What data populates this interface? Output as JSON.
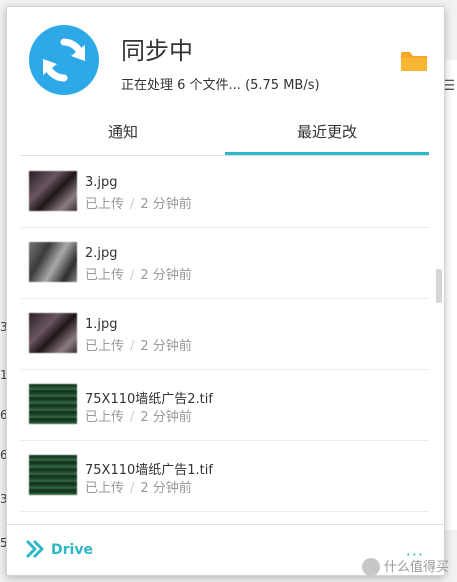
{
  "header": {
    "title": "同步中",
    "subtitle": "正在处理 6 个文件... (5.75 MB/s)"
  },
  "tabs": [
    {
      "label": "通知"
    },
    {
      "label": "最近更改"
    }
  ],
  "files": [
    {
      "name": "3.jpg",
      "status": "已上传",
      "time": "2 分钟前"
    },
    {
      "name": "2.jpg",
      "status": "已上传",
      "time": "2 分钟前"
    },
    {
      "name": "1.jpg",
      "status": "已上传",
      "time": "2 分钟前"
    },
    {
      "name": "75X110墙纸广告2.tif",
      "status": "已上传",
      "time": "2 分钟前"
    },
    {
      "name": "75X110墙纸广告1.tif",
      "status": "已上传",
      "time": "2 分钟前"
    }
  ],
  "footer": {
    "brand": "Drive",
    "more": "···"
  },
  "background": {
    "edge_chars": [
      "3",
      "1",
      "6",
      "6",
      "3",
      "5"
    ],
    "menu": "☰"
  },
  "watermark": {
    "text": "什么值得买"
  },
  "colors": {
    "accent": "#2cb8c8",
    "sync_blue": "#2ea9e8",
    "folder": "#f5a623"
  }
}
